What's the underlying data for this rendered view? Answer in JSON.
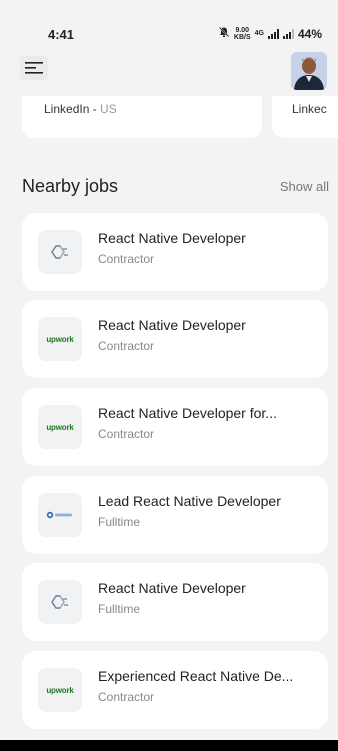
{
  "status_bar": {
    "time": "4:41",
    "net_speed_top": "9.00",
    "net_speed_bottom": "KB/S",
    "network_label": "4G",
    "battery": "44%"
  },
  "header": {
    "menu_icon": "hamburger-icon",
    "avatar": "user-avatar"
  },
  "top_cards": [
    {
      "company": "LinkedIn",
      "separator": " - ",
      "location": "US"
    },
    {
      "company": "Linkec",
      "separator": "",
      "location": ""
    }
  ],
  "nearby": {
    "title": "Nearby jobs",
    "show_all": "Show all",
    "jobs": [
      {
        "title": "React Native Developer",
        "type": "Contractor",
        "logo": "diamond-logo"
      },
      {
        "title": "React Native Developer",
        "type": "Contractor",
        "logo": "upwork-logo",
        "logo_text": "upwork"
      },
      {
        "title": "React Native Developer for...",
        "type": "Contractor",
        "logo": "upwork-logo",
        "logo_text": "upwork"
      },
      {
        "title": "Lead React Native Developer",
        "type": "Fulltime",
        "logo": "company-logo"
      },
      {
        "title": "React Native Developer",
        "type": "Fulltime",
        "logo": "diamond-logo"
      },
      {
        "title": "Experienced React Native De...",
        "type": "Contractor",
        "logo": "upwork-logo",
        "logo_text": "upwork"
      }
    ]
  },
  "colors": {
    "background": "#f3f3f6",
    "card": "#ffffff",
    "upwork_green": "#1f7a1f",
    "muted_text": "#888888"
  }
}
